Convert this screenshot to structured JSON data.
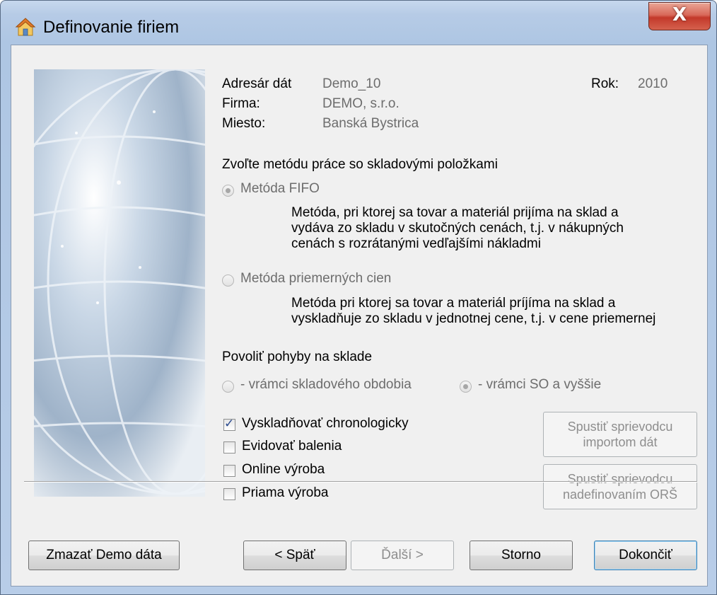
{
  "window": {
    "title": "Definovanie firiem",
    "close_label": "X"
  },
  "info": {
    "data_dir_label": "Adresár dát",
    "data_dir_value": "Demo_10",
    "firm_label": "Firma:",
    "firm_value": "DEMO, s.r.o.",
    "city_label": "Miesto:",
    "city_value": "Banská Bystrica",
    "year_label": "Rok:",
    "year_value": "2010"
  },
  "method": {
    "heading": "Zvoľte metódu práce so skladovými položkami",
    "fifo_label": "Metóda FIFO",
    "fifo_desc_1": "Metóda, pri ktorej sa tovar a materiál prijíma na sklad a",
    "fifo_desc_2": "vydáva zo skladu v skutočných cenách, t.j. v nákupných",
    "fifo_desc_3": "cenách s rozrátanými vedľajšími nákladmi",
    "avg_label": "Metóda priemerných cien",
    "avg_desc_1": "Metóda pri ktorej sa tovar a materiál príjíma na sklad a",
    "avg_desc_2": "vyskladňuje zo skladu v jednotnej cene, t.j. v cene priemernej",
    "selected": "fifo"
  },
  "movements": {
    "heading": "Povoliť pohyby na sklade",
    "option_1": "- vrámci skladového obdobia",
    "option_2": "- vrámci SO a vyššie",
    "selected": "option_2"
  },
  "options": [
    {
      "label": "Vyskladňovať chronologicky",
      "checked": true
    },
    {
      "label": "Evidovať balenia",
      "checked": false
    },
    {
      "label": "Online výroba",
      "checked": false
    },
    {
      "label": "Priama výroba",
      "checked": false
    }
  ],
  "wizards": {
    "import_line1": "Spustiť sprievodcu",
    "import_line2": "importom dát",
    "ors_line1": "Spustiť sprievodcu",
    "ors_line2": "nadefinovaním ORŠ"
  },
  "buttons": {
    "delete_demo": "Zmazať Demo dáta",
    "back": "< Späť",
    "next": "Ďalší >",
    "cancel": "Storno",
    "finish": "Dokončiť"
  },
  "colors": {
    "accent": "#3c7fb1",
    "disabled_text": "#8e8e8e",
    "close_red": "#c3392a"
  }
}
